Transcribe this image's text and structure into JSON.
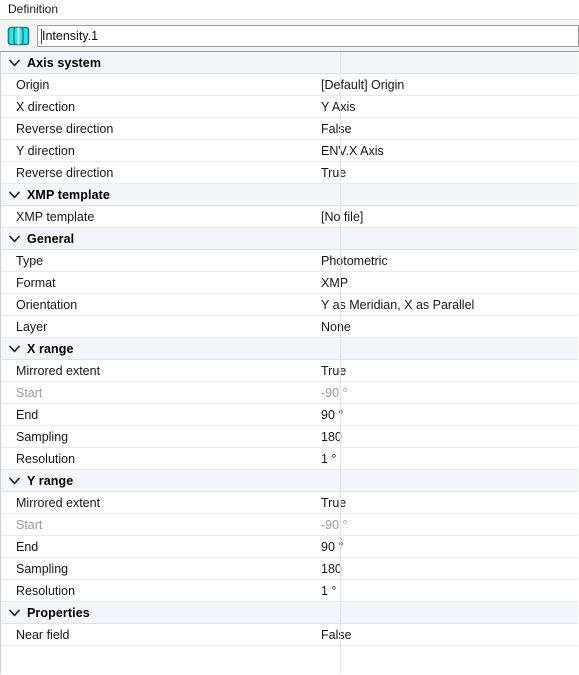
{
  "panel": {
    "title": "Definition",
    "object_icon": "photometric-distribution-icon",
    "name_field": {
      "value": "Intensity.1",
      "placeholder": "Intensity.1"
    }
  },
  "colors": {
    "group_header_bg": "#f2f5f9",
    "row_border": "#e8eaee",
    "disabled_text": "#9a9a9a",
    "icon_cyan": "#2fe6e6",
    "icon_border": "#1f7f8c"
  },
  "property_grid": {
    "expand_icon": "chevron-down-icon",
    "groups": [
      {
        "label": "Axis system",
        "expanded": true,
        "rows": [
          {
            "label": "Origin",
            "value": "[Default] Origin",
            "disabled": false
          },
          {
            "label": "X direction",
            "value": "Y Axis",
            "disabled": false
          },
          {
            "label": "Reverse direction",
            "value": "False",
            "disabled": false
          },
          {
            "label": "Y direction",
            "value": "ENV.X Axis",
            "disabled": false
          },
          {
            "label": "Reverse direction",
            "value": "True",
            "disabled": false
          }
        ]
      },
      {
        "label": "XMP template",
        "expanded": true,
        "rows": [
          {
            "label": "XMP template",
            "value": "[No file]",
            "disabled": false
          }
        ]
      },
      {
        "label": "General",
        "expanded": true,
        "rows": [
          {
            "label": "Type",
            "value": "Photometric",
            "disabled": false
          },
          {
            "label": "Format",
            "value": "XMP",
            "disabled": false
          },
          {
            "label": "Orientation",
            "value": "Y as Meridian, X as Parallel",
            "disabled": false
          },
          {
            "label": "Layer",
            "value": "None",
            "disabled": false
          }
        ]
      },
      {
        "label": "X range",
        "expanded": true,
        "rows": [
          {
            "label": "Mirrored extent",
            "value": "True",
            "disabled": false
          },
          {
            "label": "Start",
            "value": "-90 °",
            "disabled": true
          },
          {
            "label": "End",
            "value": "90 °",
            "disabled": false
          },
          {
            "label": "Sampling",
            "value": "180",
            "disabled": false
          },
          {
            "label": "Resolution",
            "value": "1 °",
            "disabled": false
          }
        ]
      },
      {
        "label": "Y range",
        "expanded": true,
        "rows": [
          {
            "label": "Mirrored extent",
            "value": "True",
            "disabled": false
          },
          {
            "label": "Start",
            "value": "-90 °",
            "disabled": true
          },
          {
            "label": "End",
            "value": "90 °",
            "disabled": false
          },
          {
            "label": "Sampling",
            "value": "180",
            "disabled": false
          },
          {
            "label": "Resolution",
            "value": "1 °",
            "disabled": false
          }
        ]
      },
      {
        "label": "Properties",
        "expanded": true,
        "rows": [
          {
            "label": "Near field",
            "value": "False",
            "disabled": false
          }
        ]
      }
    ]
  }
}
